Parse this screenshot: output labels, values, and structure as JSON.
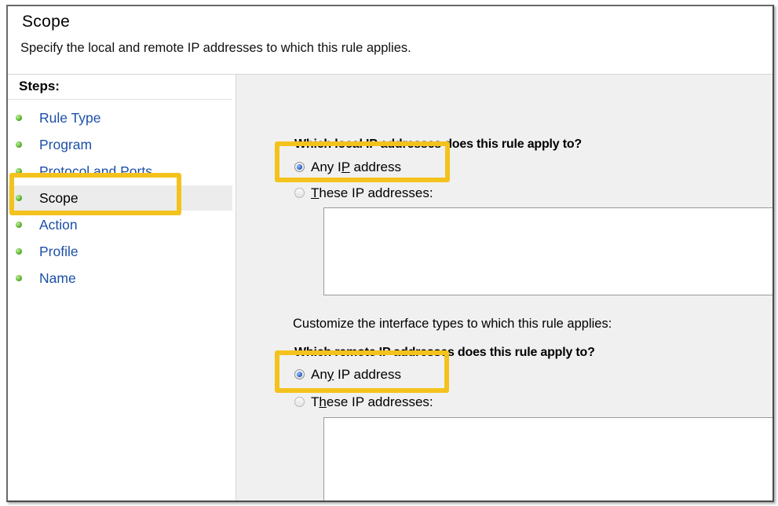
{
  "header": {
    "title": "Scope",
    "description": "Specify the local and remote IP addresses to which this rule applies."
  },
  "steps": {
    "title": "Steps:",
    "items": [
      {
        "label": "Rule Type",
        "active": false
      },
      {
        "label": "Program",
        "active": false
      },
      {
        "label": "Protocol and Ports",
        "active": false
      },
      {
        "label": "Scope",
        "active": true
      },
      {
        "label": "Action",
        "active": false
      },
      {
        "label": "Profile",
        "active": false
      },
      {
        "label": "Name",
        "active": false
      }
    ]
  },
  "local": {
    "question": "Which local IP addresses does this rule apply to?",
    "any_label_pre": "Any I",
    "any_label_accel": "P",
    "any_label_post": " address",
    "these_label_pre": "",
    "these_label_accel": "T",
    "these_label_post": "hese IP addresses:",
    "selected": "any"
  },
  "customize_label": "Customize the interface types to which this rule applies:",
  "remote": {
    "question": "Which remote IP addresses does this rule apply to?",
    "any_label_pre": "An",
    "any_label_accel": "y",
    "any_label_post": " IP address",
    "these_label_pre": "T",
    "these_label_accel": "h",
    "these_label_post": "ese IP addresses:",
    "selected": "any"
  },
  "highlight_color": "#f4c21d",
  "step_link_color": "#1c4fa8",
  "step_bullet_color": "#5db832"
}
